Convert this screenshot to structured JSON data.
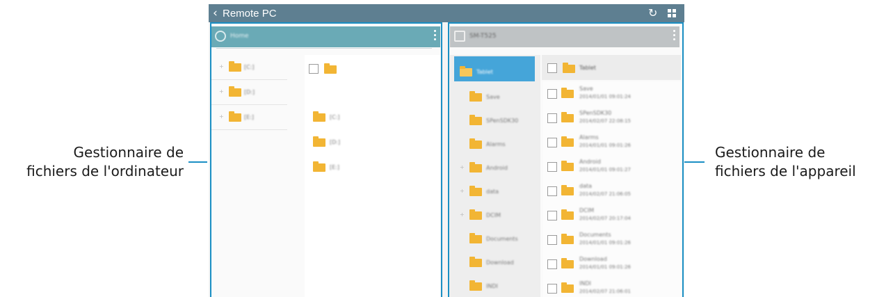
{
  "window": {
    "title": "Remote PC"
  },
  "annotations": {
    "left": [
      "Gestionnaire de",
      "fichiers de l'ordinateur"
    ],
    "right": [
      "Gestionnaire de",
      "fichiers de l'appareil"
    ]
  },
  "pc_panel": {
    "header": "Home",
    "tree": [
      "[C:]",
      "[D:]",
      "[E:]"
    ],
    "items": [
      "[C:]",
      "[D:]",
      "[E:]"
    ]
  },
  "device_panel": {
    "header": "SM-T525",
    "sidebar": [
      "Tablet",
      "Save",
      "SPenSDK30",
      "Alarms",
      "Android",
      "data",
      "DCIM",
      "Documents",
      "Download",
      "INDI"
    ],
    "list_header": "Tablet",
    "files": [
      {
        "name": "Save",
        "date": "2014/01/01 09:01:24"
      },
      {
        "name": "SPenSDK30",
        "date": "2014/02/07 22:08:15"
      },
      {
        "name": "Alarms",
        "date": "2014/01/01 09:01:26"
      },
      {
        "name": "Android",
        "date": "2014/01/01 09:01:27"
      },
      {
        "name": "data",
        "date": "2014/02/07 21:06:05"
      },
      {
        "name": "DCIM",
        "date": "2014/02/07 20:17:04"
      },
      {
        "name": "Documents",
        "date": "2014/01/01 09:01:26"
      },
      {
        "name": "Download",
        "date": "2014/01/01 09:01:26"
      },
      {
        "name": "INDI",
        "date": "2014/02/07 21:06:01"
      }
    ]
  },
  "colors": {
    "accent": "#1a8fc4",
    "titlebar": "#5e7f91",
    "pc_header": "#6aaab6",
    "folder": "#f2b534",
    "selection": "#45a5d9"
  }
}
